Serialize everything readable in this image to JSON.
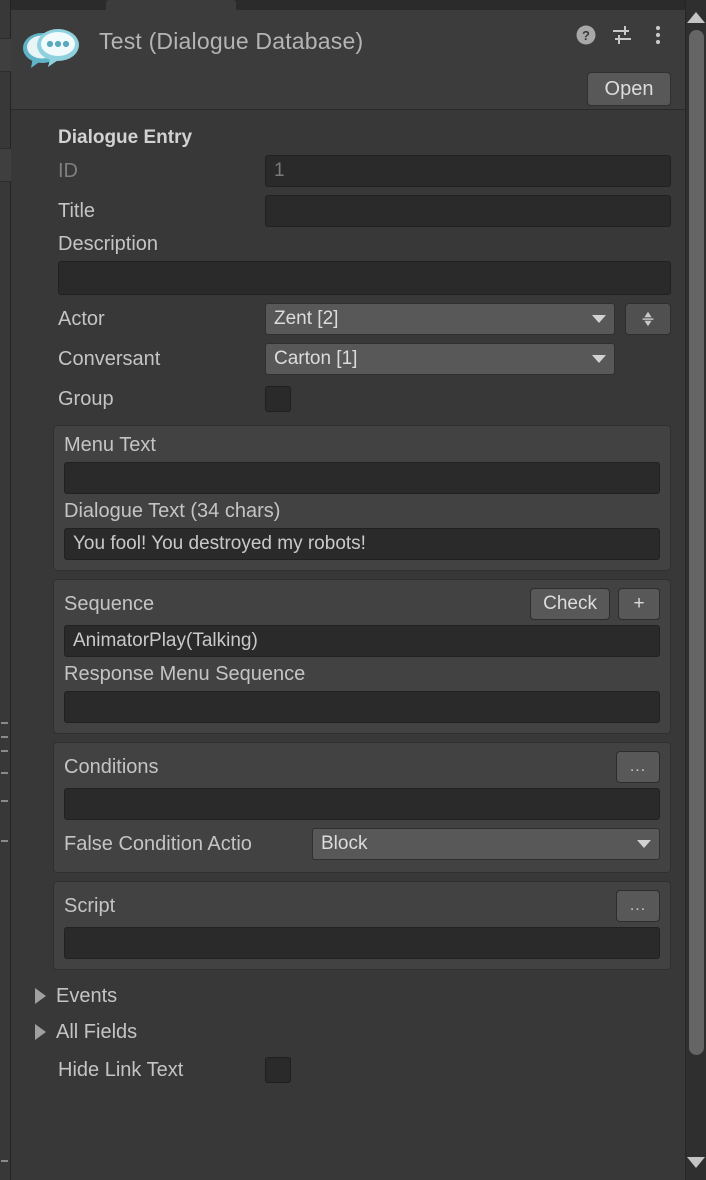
{
  "header": {
    "title": "Test (Dialogue Database)",
    "icon": "dialogue-database-icon",
    "help_icon": "help-icon",
    "preset_icon": "preset-sliders-icon",
    "menu_icon": "kebab-menu-icon",
    "open_label": "Open"
  },
  "section": {
    "title": "Dialogue Entry"
  },
  "fields": {
    "id_label": "ID",
    "id_value": "1",
    "title_label": "Title",
    "title_value": "",
    "description_label": "Description",
    "description_value": "",
    "actor_label": "Actor",
    "actor_value": "Zent [2]",
    "conversant_label": "Conversant",
    "conversant_value": "Carton [1]",
    "group_label": "Group",
    "group_checked": false,
    "swap_icon": "swap-actors-icon"
  },
  "text_group": {
    "menu_text_label": "Menu Text",
    "menu_text_value": "",
    "dialogue_text_label": "Dialogue Text (34 chars)",
    "dialogue_text_value": "You fool! You destroyed my robots!"
  },
  "sequence_group": {
    "title": "Sequence",
    "check_label": "Check",
    "add_label": "+",
    "sequence_value": "AnimatorPlay(Talking)",
    "sequence_focused": true,
    "response_menu_label": "Response Menu Sequence",
    "response_menu_value": ""
  },
  "conditions_group": {
    "title": "Conditions",
    "more_label": "...",
    "conditions_value": "",
    "false_condition_label": "False Condition Actio",
    "false_condition_value": "Block"
  },
  "script_group": {
    "title": "Script",
    "more_label": "...",
    "script_value": ""
  },
  "foldouts": [
    {
      "label": "Events",
      "expanded": false
    },
    {
      "label": "All Fields",
      "expanded": false
    }
  ],
  "bottom": {
    "hide_link_text_label": "Hide Link Text",
    "hide_link_text_checked": false
  },
  "colors": {
    "panel": "#383838",
    "header": "#3c3c3c",
    "group": "#424242",
    "input": "#2a2a2a",
    "button": "#585858",
    "focus_outline": "#4b8ad6",
    "icon_teal": "#79c4d4",
    "text": "#c4c4c4",
    "text_dim": "#7f7f7f"
  },
  "scrollbar": {
    "up_icon": "scroll-up-arrow-icon",
    "down_icon": "scroll-down-arrow-icon"
  }
}
